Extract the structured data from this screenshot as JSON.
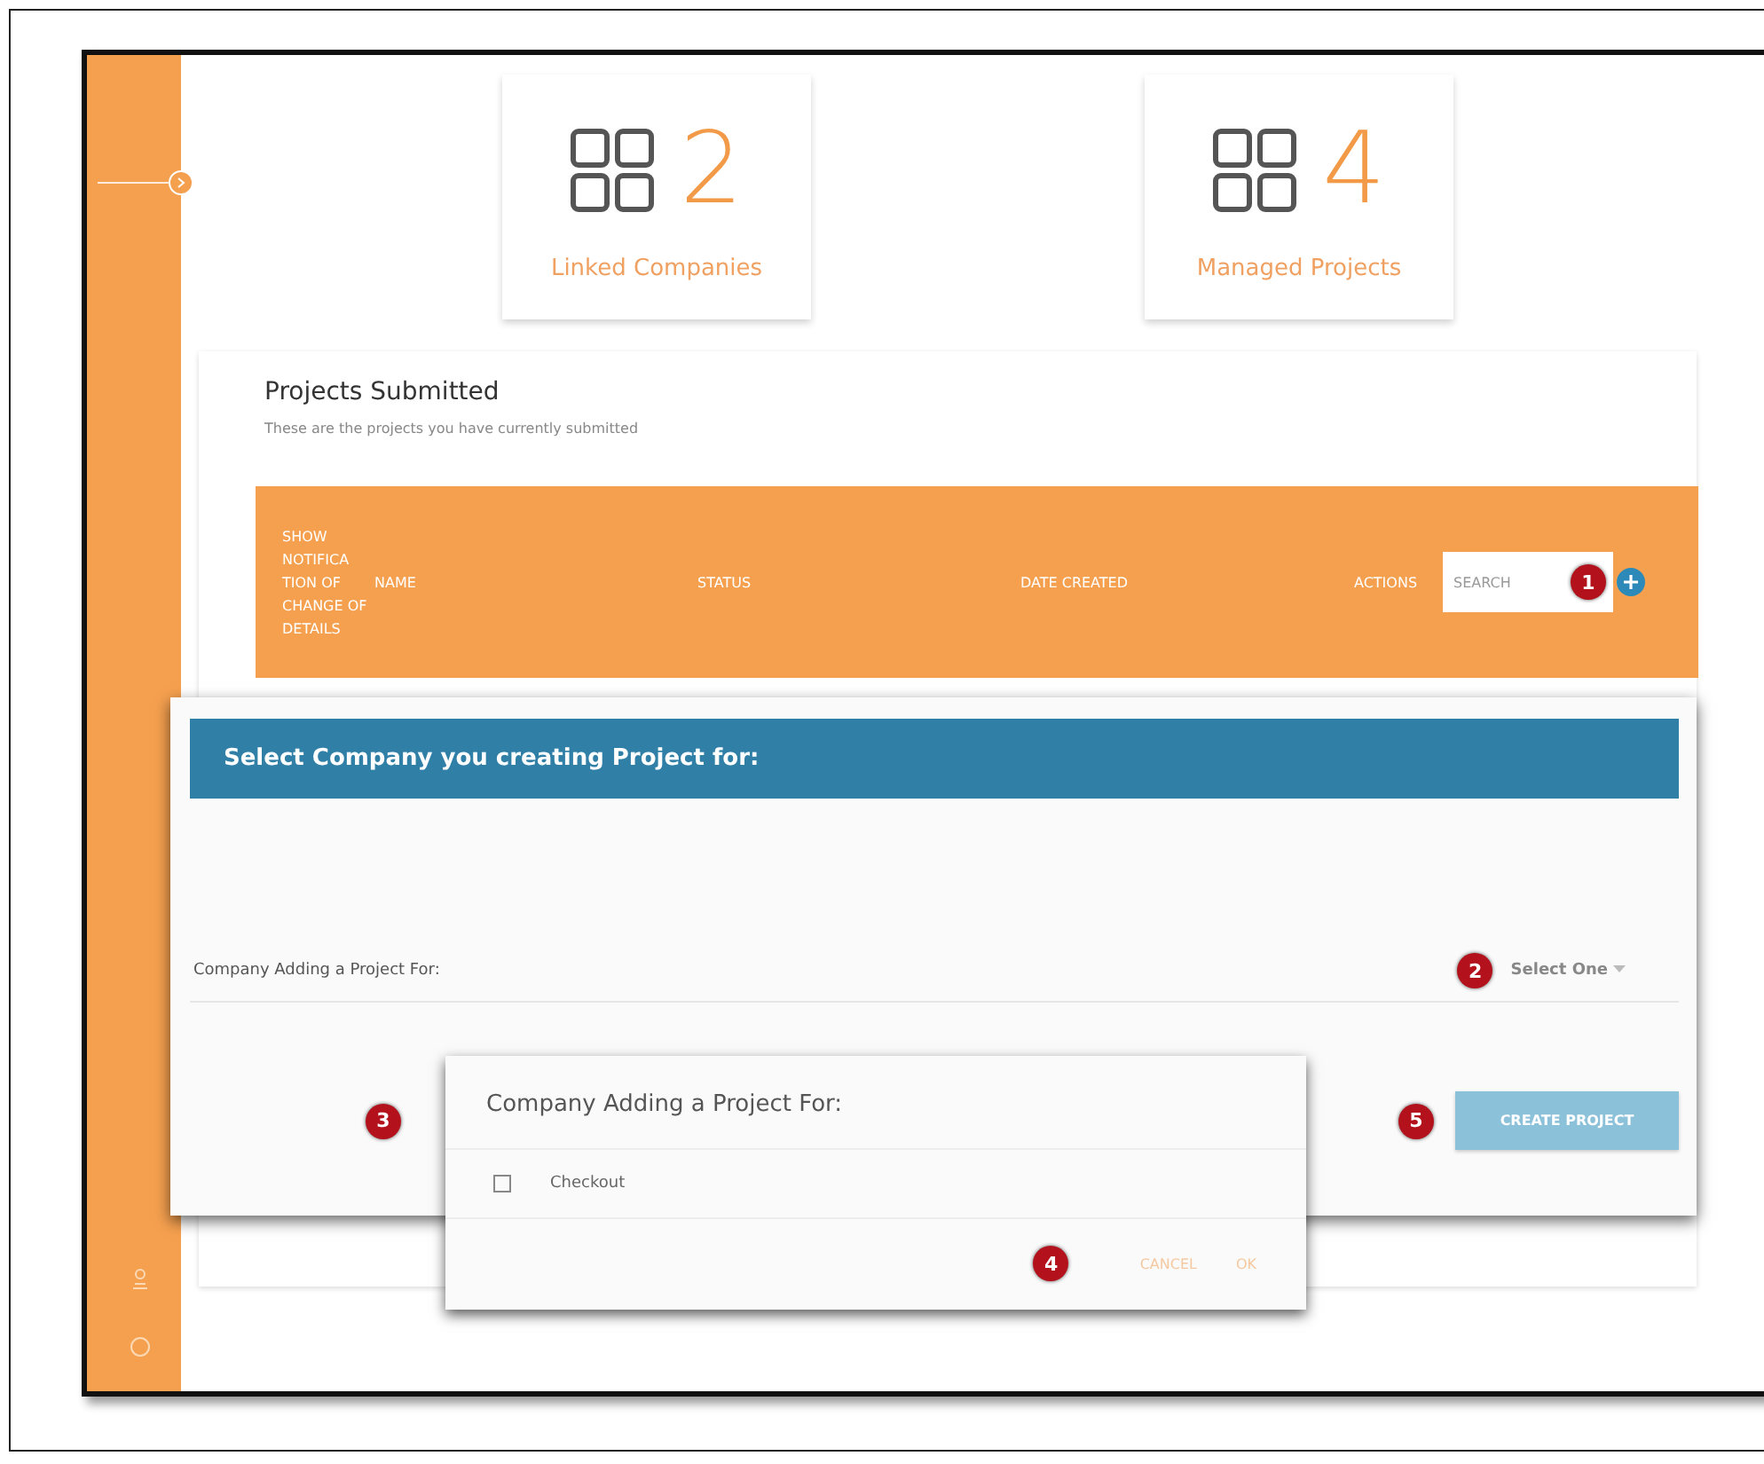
{
  "stats": [
    {
      "value": "2",
      "label": "Linked Companies"
    },
    {
      "value": "4",
      "label": "Managed Projects"
    }
  ],
  "projects": {
    "title": "Projects Submitted",
    "subtitle": "These are the projects you have currently submitted",
    "columns": [
      "SHOW NOTIFICA TION OF CHANGE OF DETAILS",
      "NAME",
      "STATUS",
      "DATE CREATED",
      "ACTIONS"
    ],
    "search": {
      "placeholder": "SEARCH"
    }
  },
  "dialog": {
    "title": "Select Company you creating Project for:",
    "field_label": "Company Adding a Project For:",
    "select": {
      "placeholder": "Select One"
    },
    "button": "CREATE PROJECT"
  },
  "picker": {
    "title": "Company Adding a Project For:",
    "options": [
      {
        "label": "Checkout",
        "checked": false
      }
    ],
    "buttons": [
      "CANCEL",
      "OK"
    ]
  },
  "markers": [
    "1",
    "2",
    "3",
    "4",
    "5"
  ]
}
